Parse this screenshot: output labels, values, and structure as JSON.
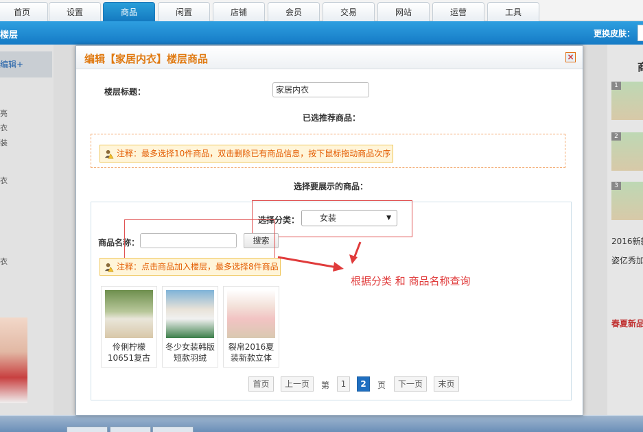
{
  "top_tabs": [
    "首页",
    "设置",
    "商品",
    "闲置",
    "店铺",
    "会员",
    "交易",
    "网站",
    "运营",
    "工具"
  ],
  "active_tab": "商品",
  "header": {
    "left_title": "楼层",
    "skin_label": "更换皮肤："
  },
  "background": {
    "side_edit": "编辑+",
    "side_text": [
      "亮",
      "衣",
      "装",
      "衣",
      "衣"
    ],
    "right_header": "商",
    "right_nums": [
      "1",
      "2",
      "3"
    ],
    "right_texts": [
      "2016新款",
      "姿亿秀加"
    ],
    "right_red": "春夏新品"
  },
  "dialog": {
    "title": "编辑【家居内衣】楼层商品",
    "close_symbol": "×",
    "floor_title_label": "楼层标题：",
    "floor_title_value": "家居内衣",
    "selected_heading": "已选推荐商品：",
    "note_selected": "注释：最多选择10件商品，双击删除已有商品信息，按下鼠标拖动商品次序",
    "choose_heading": "选择要展示的商品：",
    "category_label": "选择分类：",
    "category_value": "女装",
    "name_label": "商品名称：",
    "name_value": "",
    "search_button": "搜索",
    "note_add": "注释：点击商品加入楼层，最多选择8件商品",
    "annotation": "根据分类 和 商品名称查询",
    "products": [
      {
        "name": "伶俐柠檬10651复古"
      },
      {
        "name": "冬少女装韩版短款羽绒"
      },
      {
        "name": "裂帛2016夏装新款立体"
      }
    ],
    "pager": {
      "first": "首页",
      "prev": "上一页",
      "page_word_before": "第",
      "pages": [
        "1",
        "2"
      ],
      "current_page": "2",
      "page_word_after": "页",
      "next": "下一页",
      "last": "末页"
    }
  },
  "colors": {
    "accent_blue": "#1a7fc8",
    "title_orange": "#e07a12",
    "annotation_red": "#e03b3b"
  }
}
